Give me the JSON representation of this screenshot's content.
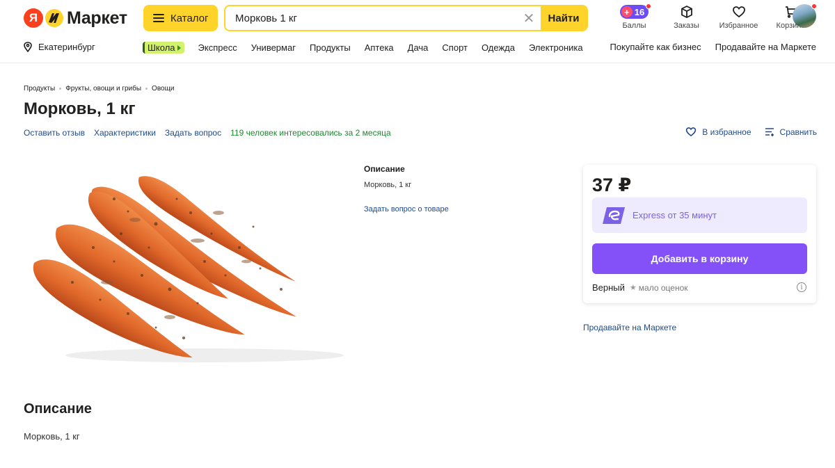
{
  "header": {
    "logo_letter": "Я",
    "logo_text": "Маркет",
    "catalog_label": "Каталог",
    "search": {
      "value": "Морковь 1 кг",
      "find_label": "Найти"
    },
    "icons": [
      {
        "name": "points",
        "label": "Баллы",
        "badge": "16"
      },
      {
        "name": "box-icon",
        "label": "Заказы"
      },
      {
        "name": "heart-icon",
        "label": "Избранное"
      },
      {
        "name": "cart-icon",
        "label": "Корзина"
      }
    ]
  },
  "subnav": {
    "city": "Екатеринбург",
    "school_label": "Школа",
    "links": [
      "Экспресс",
      "Универмаг",
      "Продукты",
      "Аптека",
      "Дача",
      "Спорт",
      "Одежда",
      "Электроника"
    ],
    "right_links": [
      "Покупайте как бизнес",
      "Продавайте на Маркете"
    ]
  },
  "breadcrumb": [
    "Продукты",
    "Фрукты, овощи и грибы",
    "Овощи"
  ],
  "product": {
    "title": "Морковь, 1 кг",
    "actions": [
      "Оставить отзыв",
      "Характеристики",
      "Задать вопрос"
    ],
    "interest": "119 человек интересовались за 2 месяца",
    "favorite_label": "В избранное",
    "compare_label": "Сравнить",
    "desc_mini_heading": "Описание",
    "desc_mini_text": "Морковь, 1 кг",
    "ask_about_product": "Задать вопрос о товаре"
  },
  "buy_card": {
    "price": "37 ₽",
    "express_text": "Express от 35 минут",
    "add_to_cart": "Добавить в корзину",
    "shop_name": "Верный",
    "shop_rating": "мало оценок"
  },
  "sell_link": "Продавайте на Маркете",
  "description": {
    "heading": "Описание",
    "text": "Морковь, 1 кг"
  },
  "colors": {
    "accent_yellow": "#fed42b",
    "purple": "#8451f8",
    "link_blue": "#1f4a8c",
    "green": "#1a8a2d"
  }
}
